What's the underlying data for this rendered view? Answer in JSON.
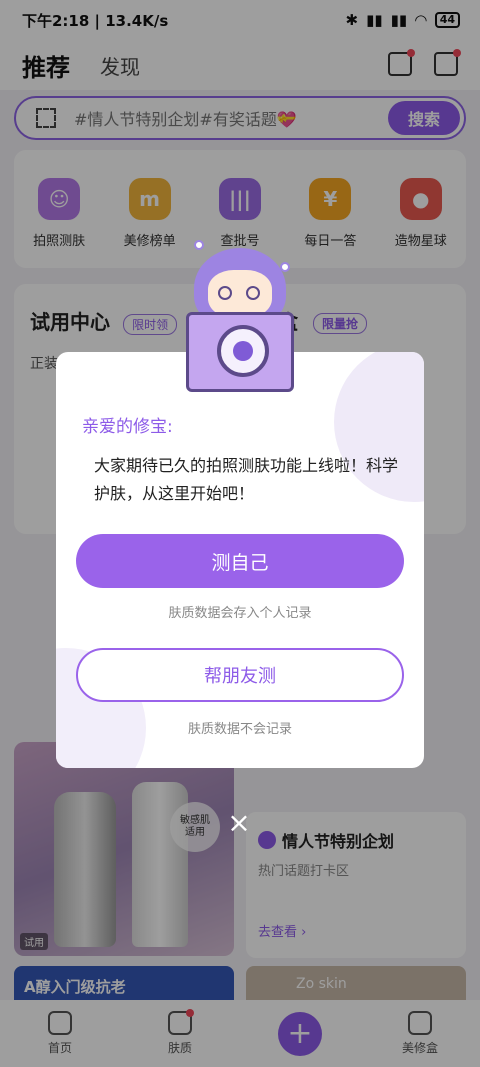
{
  "status_bar": {
    "time_speed": "下午2:18 | 13.4K/s",
    "battery": "44"
  },
  "header": {
    "tab_active": "推荐",
    "tab_other": "发现"
  },
  "search": {
    "placeholder": "#情人节特别企划#有奖话题💝",
    "button": "搜索"
  },
  "quick_entries": [
    {
      "label": "拍照测肤",
      "icon": "face-scan-icon",
      "color": "#b47ae8"
    },
    {
      "label": "美修榜单",
      "icon": "medal-icon",
      "color": "#f2b53c"
    },
    {
      "label": "查批号",
      "icon": "barcode-icon",
      "color": "#9b6de6"
    },
    {
      "label": "每日一答",
      "icon": "coin-icon",
      "color": "#f5a623"
    },
    {
      "label": "造物星球",
      "icon": "planet-icon",
      "color": "#e85a4f"
    }
  ],
  "trial": {
    "title": "试用中心",
    "tag": "限时领",
    "sub": "正装",
    "right_title": "修盒",
    "right_tag": "限量抢"
  },
  "right_card": {
    "title": "情人节特别企划",
    "sub": "热门话题打卡区",
    "link": "去查看 ›"
  },
  "left_card": {
    "badge": "敏感肌\n适用",
    "tag": "试用"
  },
  "left_card2": {
    "text": "A醇入门级抗老"
  },
  "right_card2": {
    "text": "Zo skin"
  },
  "nav": {
    "home": "首页",
    "skin": "肤质",
    "box": "美修盒"
  },
  "modal": {
    "greeting": "亲爱的修宝:",
    "message": "大家期待已久的拍照测肤功能上线啦！科学护肤，从这里开始吧！",
    "primary_button": "测自己",
    "primary_note": "肤质数据会存入个人记录",
    "secondary_button": "帮朋友测",
    "secondary_note": "肤质数据不会记录"
  },
  "close": "×"
}
